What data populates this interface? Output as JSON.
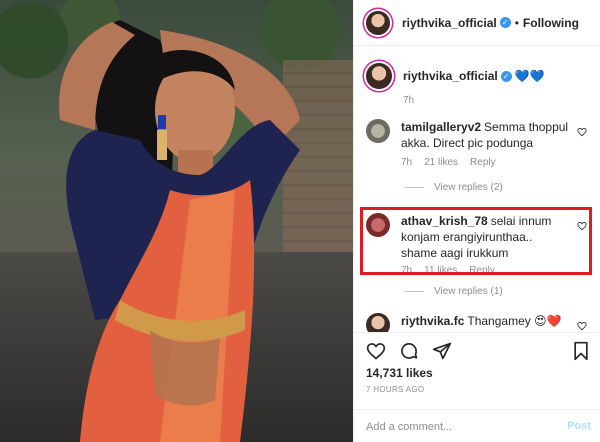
{
  "header": {
    "username": "riythvika_official",
    "verified_glyph": "✓",
    "separator": "•",
    "follow_label": "Following"
  },
  "caption": {
    "username": "riythvika_official",
    "emoji": "💙💙",
    "age": "7h"
  },
  "comments": [
    {
      "username": "tamilgalleryv2",
      "text": "Semma thoppul akka. Direct pic podunga",
      "age": "7h",
      "likes": "21 likes",
      "reply_label": "Reply",
      "view_replies": "View replies (2)"
    },
    {
      "username": "athav_krish_78",
      "text": "selai innum konjam erangiyirunthaa.. shame aagi irukkum",
      "age": "7h",
      "likes": "11 likes",
      "reply_label": "Reply",
      "view_replies": "View replies (1)",
      "highlighted": true
    },
    {
      "username": "riythvika.fc",
      "text": "Thangamey 😍❤️"
    }
  ],
  "actions": {
    "likes_count": "14,731 likes",
    "timestamp": "7 HOURS AGO",
    "comment_placeholder": "Add a comment...",
    "post_label": "Post"
  },
  "colors": {
    "highlight_border": "#e01b22",
    "verified": "#3897f0",
    "heart_blue": "#1c4fd6",
    "saree": "#e2603f",
    "blouse": "#1f2350"
  },
  "icons": [
    "verified-icon",
    "heart-icon",
    "comment-icon",
    "share-icon",
    "bookmark-icon",
    "small-heart-icon"
  ]
}
